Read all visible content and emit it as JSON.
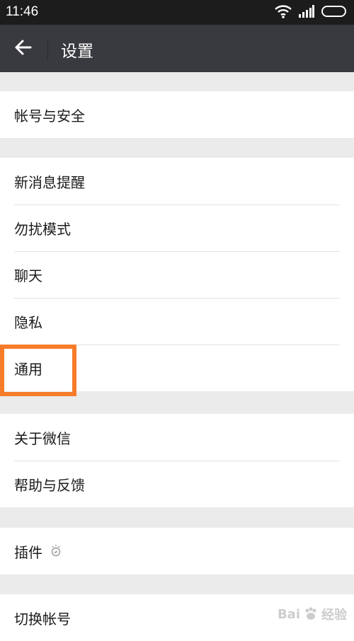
{
  "status": {
    "time": "11:46"
  },
  "header": {
    "title": "设置"
  },
  "sections": [
    {
      "items": [
        {
          "label": "帐号与安全"
        }
      ]
    },
    {
      "items": [
        {
          "label": "新消息提醒"
        },
        {
          "label": "勿扰模式"
        },
        {
          "label": "聊天"
        },
        {
          "label": "隐私"
        },
        {
          "label": "通用"
        }
      ]
    },
    {
      "items": [
        {
          "label": "关于微信"
        },
        {
          "label": "帮助与反馈"
        }
      ]
    },
    {
      "items": [
        {
          "label": "插件",
          "icon": "plugin-bulb-icon"
        }
      ]
    },
    {
      "items": [
        {
          "label": "切换帐号"
        }
      ]
    }
  ],
  "highlight": {
    "target": "通用",
    "color": "#f77c2a"
  },
  "watermark": {
    "text_left": "Bai",
    "text_right": "经验"
  },
  "colors": {
    "status_bar": "#1c1c1c",
    "title_bar": "#393a3f",
    "background": "#ebebeb"
  }
}
